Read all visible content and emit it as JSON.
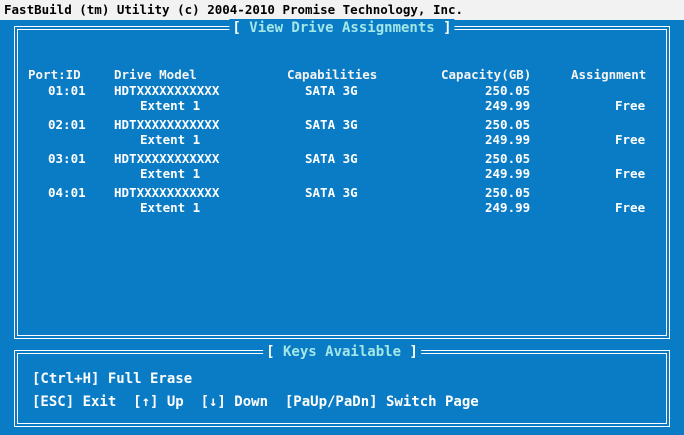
{
  "window": {
    "title": "FastBuild (tm) Utility (c) 2004-2010 Promise Technology, Inc."
  },
  "drive_panel": {
    "title": "View Drive Assignments",
    "columns": [
      "Port:ID",
      "Drive Model",
      "Capabilities",
      "Capacity(GB)",
      "Assignment"
    ],
    "rows": [
      {
        "port_id": "01:01",
        "model": "HDTXXXXXXXXXXX",
        "capabilities": "SATA 3G",
        "capacity": "250.05",
        "extent_label": "Extent 1",
        "extent_capacity": "249.99",
        "assignment": "Free"
      },
      {
        "port_id": "02:01",
        "model": "HDTXXXXXXXXXXX",
        "capabilities": "SATA 3G",
        "capacity": "250.05",
        "extent_label": "Extent 1",
        "extent_capacity": "249.99",
        "assignment": "Free"
      },
      {
        "port_id": "03:01",
        "model": "HDTXXXXXXXXXXX",
        "capabilities": "SATA 3G",
        "capacity": "250.05",
        "extent_label": "Extent 1",
        "extent_capacity": "249.99",
        "assignment": "Free"
      },
      {
        "port_id": "04:01",
        "model": "HDTXXXXXXXXXXX",
        "capabilities": "SATA 3G",
        "capacity": "250.05",
        "extent_label": "Extent 1",
        "extent_capacity": "249.99",
        "assignment": "Free"
      }
    ]
  },
  "keys_panel": {
    "title": "Keys Available",
    "line1": "[Ctrl+H] Full Erase",
    "line2": "[ESC] Exit  [↑] Up  [↓] Down  [PaUp/PaDn] Switch Page"
  },
  "colors": {
    "background": "#0a7cc6",
    "title_bar": "#f2f2f2",
    "panel_title": "#a3e7e7",
    "text": "#ffffff"
  }
}
